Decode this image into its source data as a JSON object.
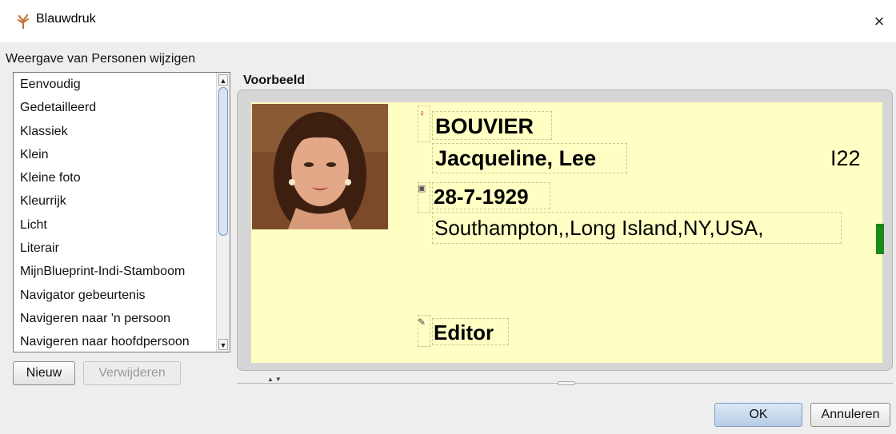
{
  "window": {
    "title": "Blauwdruk",
    "close_label": "×"
  },
  "left": {
    "section_label": "Weergave van Personen wijzigen",
    "items": [
      "Eenvoudig",
      "Gedetailleerd",
      "Klassiek",
      "Klein",
      "Kleine foto",
      "Kleurrijk",
      "Licht",
      "Literair",
      "MijnBlueprint-Indi-Stamboom",
      "Navigator gebeurtenis",
      "Navigeren naar 'n persoon",
      "Navigeren naar hoofdpersoon"
    ],
    "new_button": "Nieuw",
    "remove_button": "Verwijderen"
  },
  "preview": {
    "label": "Voorbeeld",
    "surname": "BOUVIER",
    "given_names": "Jacqueline, Lee",
    "id": "I22",
    "birth_date": "28-7-1929",
    "birth_place": "Southampton,,Long Island,NY,USA,",
    "editor": "Editor",
    "photo_icon": "portrait-photo",
    "accent_color": "#1a8a1a",
    "card_color": "#ffffc4"
  },
  "footer": {
    "ok_button": "OK",
    "cancel_button": "Annuleren"
  }
}
